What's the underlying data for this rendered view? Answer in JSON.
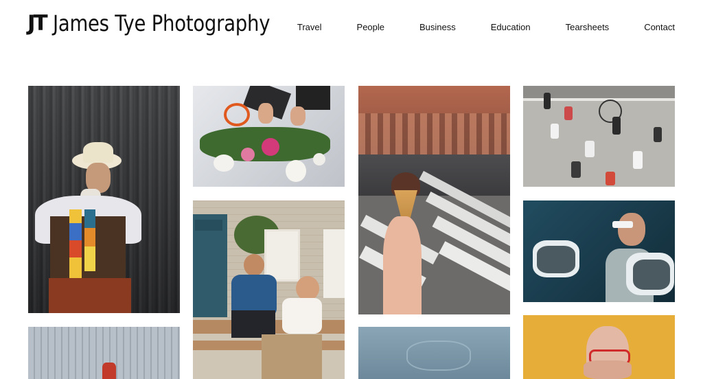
{
  "brand": {
    "mark": "JT",
    "name": "James Tye Photography"
  },
  "nav": [
    {
      "label": "Travel"
    },
    {
      "label": "People"
    },
    {
      "label": "Business"
    },
    {
      "label": "Education"
    },
    {
      "label": "Tearsheets"
    },
    {
      "label": "Contact"
    }
  ],
  "gallery": {
    "photos": [
      {
        "subject": "man-in-hat-portrait"
      },
      {
        "subject": "florist-flowers"
      },
      {
        "subject": "ice-cream-cone-street"
      },
      {
        "subject": "aerial-crosswalk-people"
      },
      {
        "subject": "two-women-bench"
      },
      {
        "subject": "vr-gloves-woman"
      },
      {
        "subject": "window-glass"
      },
      {
        "subject": "blue-wall"
      },
      {
        "subject": "man-red-glasses-yellow"
      }
    ]
  }
}
